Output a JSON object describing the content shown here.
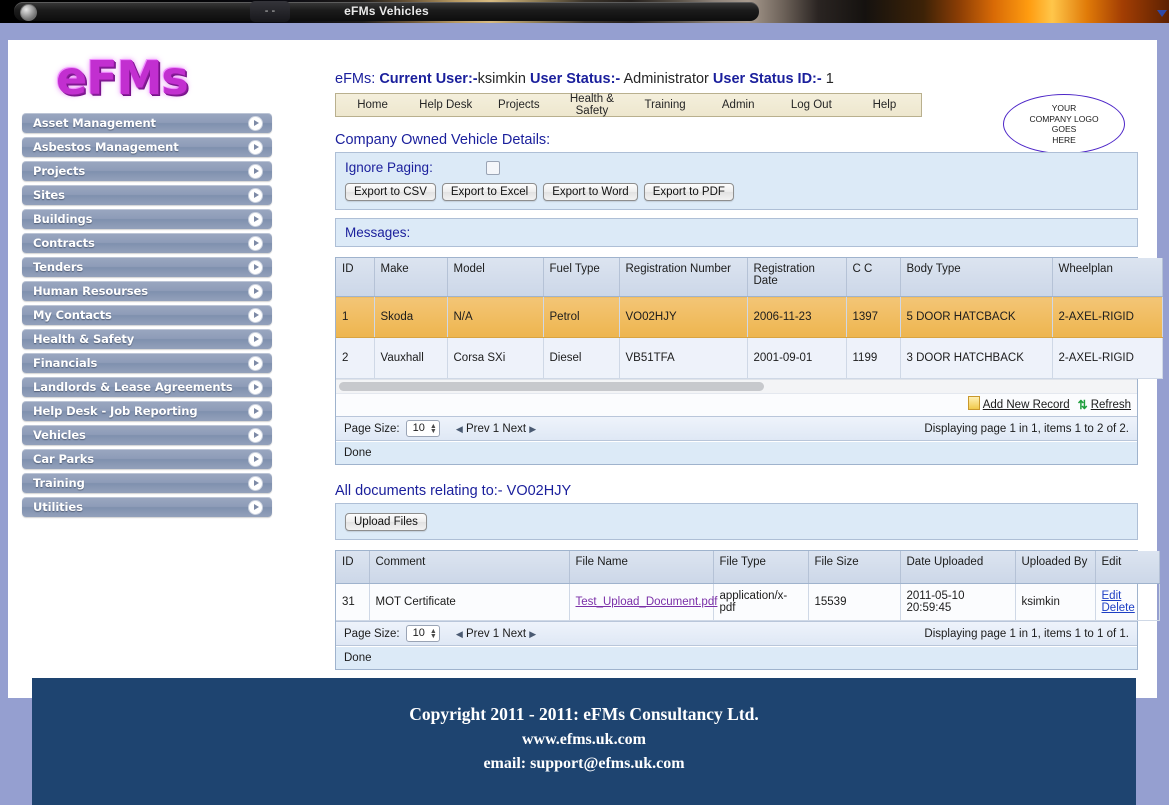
{
  "window": {
    "title": "eFMs Vehicles",
    "extra_button": "- -"
  },
  "brand": {
    "logo_text": "eFMs"
  },
  "company_logo": {
    "line1": "YOUR",
    "line2": "COMPANY LOGO",
    "line3": "GOES",
    "line4": "HERE"
  },
  "sidebar": {
    "items": [
      {
        "label": "Asset Management"
      },
      {
        "label": "Asbestos Management"
      },
      {
        "label": "Projects"
      },
      {
        "label": "Sites"
      },
      {
        "label": "Buildings"
      },
      {
        "label": "Contracts"
      },
      {
        "label": "Tenders"
      },
      {
        "label": "Human Resourses"
      },
      {
        "label": "My Contacts"
      },
      {
        "label": "Health & Safety"
      },
      {
        "label": "Financials"
      },
      {
        "label": "Landlords & Lease Agreements"
      },
      {
        "label": "Help Desk - Job Reporting"
      },
      {
        "label": "Vehicles"
      },
      {
        "label": "Car Parks"
      },
      {
        "label": "Training"
      },
      {
        "label": "Utilities"
      }
    ]
  },
  "userbar": {
    "app": "eFMs:",
    "current_user_label": "Current User:-",
    "current_user": "ksimkin",
    "user_status_label": "User Status:-",
    "user_status": "Administrator",
    "user_status_id_label": "User Status ID:-",
    "user_status_id": "1"
  },
  "menu": {
    "items": [
      {
        "label": "Home"
      },
      {
        "label": "Help Desk"
      },
      {
        "label": "Projects"
      },
      {
        "label": "Health & Safety"
      },
      {
        "label": "Training"
      },
      {
        "label": "Admin"
      },
      {
        "label": "Log Out"
      },
      {
        "label": "Help"
      }
    ]
  },
  "vehicles_section": {
    "title": "Company Owned Vehicle Details:",
    "ignore_paging_label": "Ignore Paging:",
    "ignore_paging_checked": false,
    "export_buttons": [
      {
        "label": "Export to CSV"
      },
      {
        "label": "Export to Excel"
      },
      {
        "label": "Export to Word"
      },
      {
        "label": "Export to PDF"
      }
    ],
    "messages_label": "Messages:",
    "columns": [
      "ID",
      "Make",
      "Model",
      "Fuel Type",
      "Registration Number",
      "Registration Date",
      "C C",
      "Body Type",
      "Wheelplan"
    ],
    "rows": [
      {
        "id": "1",
        "make": "Skoda",
        "model": "N/A",
        "fuel_type": "Petrol",
        "registration_number": "VO02HJY",
        "registration_date": "2006-11-23",
        "cc": "1397",
        "body_type": "5 DOOR HATCBACK",
        "wheelplan": "2-AXEL-RIGID",
        "selected": true
      },
      {
        "id": "2",
        "make": "Vauxhall",
        "model": "Corsa SXi",
        "fuel_type": "Diesel",
        "registration_number": "VB51TFA",
        "registration_date": "2001-09-01",
        "cc": "1199",
        "body_type": "3 DOOR HATCHBACK",
        "wheelplan": "2-AXEL-RIGID",
        "selected": false
      }
    ],
    "actions": {
      "add_new_record": "Add New Record",
      "refresh": "Refresh"
    },
    "pager": {
      "page_size_label": "Page Size:",
      "page_size_value": "10",
      "prev": "Prev",
      "page": "1",
      "next": "Next",
      "summary": "Displaying page 1 in 1, items 1 to 2 of 2."
    },
    "status": "Done"
  },
  "documents_section": {
    "title": "All documents relating to:- VO02HJY",
    "upload_button": "Upload Files",
    "columns": [
      "ID",
      "Comment",
      "File Name",
      "File Type",
      "File Size",
      "Date Uploaded",
      "Uploaded By",
      "Edit"
    ],
    "rows": [
      {
        "id": "31",
        "comment": "MOT Certificate",
        "file_name": "Test_Upload_Document.pdf",
        "file_type": "application/x-pdf",
        "file_size": "15539",
        "date_uploaded": "2011-05-10 20:59:45",
        "uploaded_by": "ksimkin",
        "edit": "Edit",
        "delete": "Delete"
      }
    ],
    "pager": {
      "page_size_label": "Page Size:",
      "page_size_value": "10",
      "prev": "Prev",
      "page": "1",
      "next": "Next",
      "summary": "Displaying page 1 in 1, items 1 to 1 of 1."
    },
    "status": "Done"
  },
  "footer": {
    "line1": "Copyright 2011 - 2011: eFMs Consultancy Ltd.",
    "line2": "www.efms.uk.com",
    "line3": "email: support@efms.uk.com"
  },
  "colors": {
    "page_background": "#959fd0",
    "footer_background": "#1e4470",
    "accent_blue": "#1a1f9c",
    "selected_row": "#eeb54e",
    "panel_blue": "#dceaf7"
  }
}
